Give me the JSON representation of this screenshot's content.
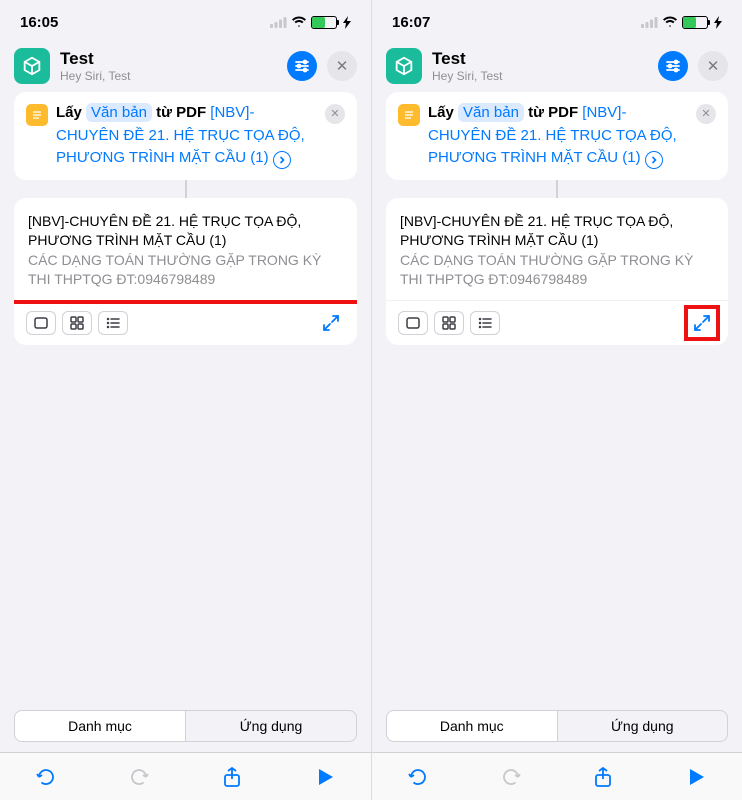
{
  "screens": [
    {
      "status_time": "16:05",
      "title": "Test",
      "subtitle": "Hey Siri, Test",
      "action": {
        "verb": "Lấy",
        "var1": "Văn bản",
        "mid": "từ PDF",
        "file": "[NBV]-CHUYÊN ĐỀ 21. HỆ TRỤC TỌA ĐỘ, PHƯƠNG TRÌNH MẶT CẦU (1)"
      },
      "result": {
        "title": "[NBV]-CHUYÊN ĐỀ 21. HỆ TRỤC TỌA ĐỘ, PHƯƠNG TRÌNH MẶT CẦU (1)",
        "subtitle": "CÁC DẠNG TOÁN THƯỜNG GẶP TRONG KỲ THI THPTQG ĐT:0946798489"
      },
      "highlight": "body",
      "tabs": {
        "left": "Danh mục",
        "right": "Ứng dụng"
      }
    },
    {
      "status_time": "16:07",
      "title": "Test",
      "subtitle": "Hey Siri, Test",
      "action": {
        "verb": "Lấy",
        "var1": "Văn bản",
        "mid": "từ PDF",
        "file": "[NBV]-CHUYÊN ĐỀ 21. HỆ TRỤC TỌA ĐỘ, PHƯƠNG TRÌNH MẶT CẦU (1)"
      },
      "result": {
        "title": "[NBV]-CHUYÊN ĐỀ 21. HỆ TRỤC TỌA ĐỘ, PHƯƠNG TRÌNH MẶT CẦU (1)",
        "subtitle": "CÁC DẠNG TOÁN THƯỜNG GẶP TRONG KỲ THI THPTQG ĐT:0946798489"
      },
      "highlight": "expand",
      "tabs": {
        "left": "Danh mục",
        "right": "Ứng dụng"
      }
    }
  ]
}
